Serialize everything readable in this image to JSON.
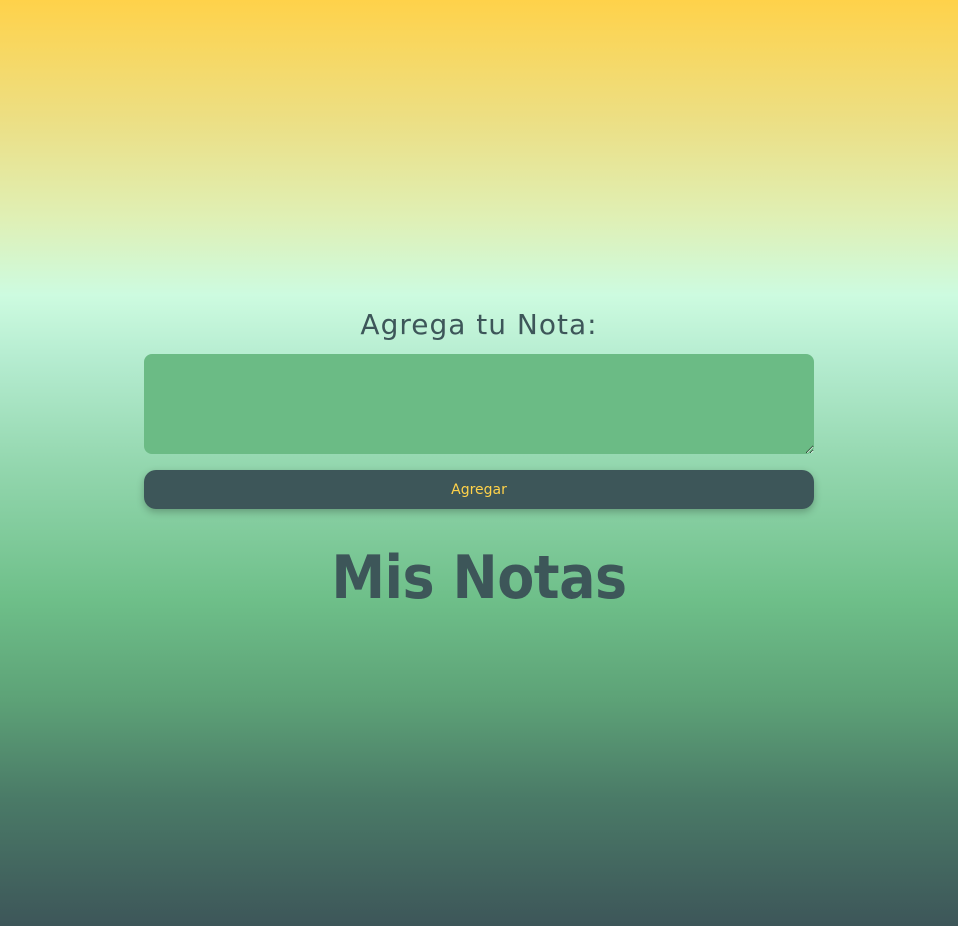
{
  "form": {
    "label": "Agrega tu Nota:",
    "textarea_value": "",
    "textarea_placeholder": "",
    "button_label": "Agregar"
  },
  "notes": {
    "title": "Mis Notas",
    "items": []
  },
  "colors": {
    "gradient_top": "#ffd24a",
    "gradient_mid": "#cdfbe0",
    "gradient_bottom": "#3d5659",
    "textarea_bg": "#6bbb85",
    "button_bg": "#3d5659",
    "button_text": "#ffd24a",
    "text": "#3d5659"
  }
}
